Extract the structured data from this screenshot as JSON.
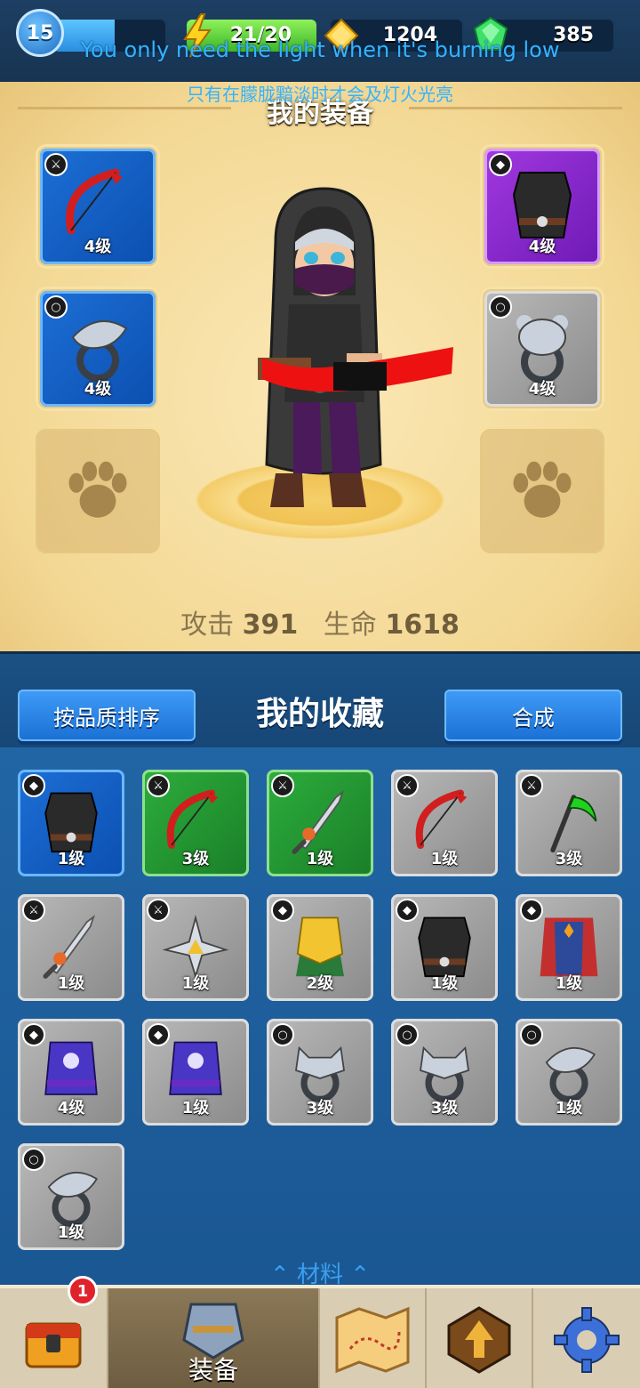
{
  "topbar": {
    "level": "15",
    "xp_fraction": 0.55,
    "energy": "21/20",
    "gold": "1204",
    "gems": "385"
  },
  "subtitles": {
    "en": "You only need the light when it's burning low",
    "zh": "只有在朦胧黯淡时才会及灯火光亮"
  },
  "equipment": {
    "title": "我的装备",
    "slots": [
      {
        "item": "bow-icon",
        "quality": "blue",
        "level": "4级",
        "slot_type": "weapon"
      },
      {
        "item": "armor-icon",
        "quality": "purple",
        "level": "4级",
        "slot_type": "armor"
      },
      {
        "item": "eagle-ring-icon",
        "quality": "blue",
        "level": "4级",
        "slot_type": "ring"
      },
      {
        "item": "bear-ring-icon",
        "quality": "gray",
        "level": "4级",
        "slot_type": "ring"
      }
    ],
    "attack_label": "攻击",
    "attack_value": "391",
    "hp_label": "生命",
    "hp_value": "1618"
  },
  "collection": {
    "sort_button": "按品质排序",
    "title": "我的收藏",
    "merge_button": "合成",
    "items": [
      {
        "item": "armor-icon",
        "quality": "blue",
        "level": "1级",
        "slot_type": "armor"
      },
      {
        "item": "bow-icon",
        "quality": "green",
        "level": "3级",
        "slot_type": "weapon"
      },
      {
        "item": "sword-icon",
        "quality": "green",
        "level": "1级",
        "slot_type": "weapon"
      },
      {
        "item": "bow-icon",
        "quality": "gray",
        "level": "1级",
        "slot_type": "weapon"
      },
      {
        "item": "scythe-icon",
        "quality": "gray",
        "level": "3级",
        "slot_type": "weapon"
      },
      {
        "item": "sword-icon",
        "quality": "gray",
        "level": "1级",
        "slot_type": "weapon"
      },
      {
        "item": "shuriken-icon",
        "quality": "gray",
        "level": "1级",
        "slot_type": "weapon"
      },
      {
        "item": "gold-armor-icon",
        "quality": "gray",
        "level": "2级",
        "slot_type": "armor"
      },
      {
        "item": "armor-icon",
        "quality": "gray",
        "level": "1级",
        "slot_type": "armor"
      },
      {
        "item": "robe-icon",
        "quality": "gray",
        "level": "1级",
        "slot_type": "armor"
      },
      {
        "item": "mage-armor-icon",
        "quality": "gray",
        "level": "4级",
        "slot_type": "armor"
      },
      {
        "item": "mage-armor-icon",
        "quality": "gray",
        "level": "1级",
        "slot_type": "armor"
      },
      {
        "item": "wolf-ring-icon",
        "quality": "gray",
        "level": "3级",
        "slot_type": "ring"
      },
      {
        "item": "wolf-ring-icon",
        "quality": "gray",
        "level": "3级",
        "slot_type": "ring"
      },
      {
        "item": "eagle-ring-icon",
        "quality": "gray",
        "level": "1级",
        "slot_type": "ring"
      },
      {
        "item": "eagle-ring-icon",
        "quality": "gray",
        "level": "1级",
        "slot_type": "ring"
      }
    ],
    "materials_label": "材料"
  },
  "nav": {
    "chest_badge": "1",
    "equip_label": "装备"
  },
  "colors": {
    "blue": "#1c6fd6",
    "purple": "#a238e0",
    "green": "#2dae3c",
    "gray": "#9e9e9e"
  }
}
